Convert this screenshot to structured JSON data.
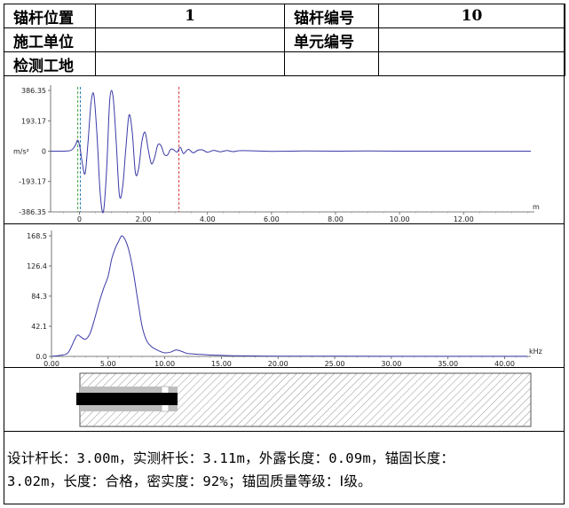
{
  "info_table": {
    "anchor_position_label": "锚杆位置",
    "anchor_position_value": "1",
    "anchor_number_label": "锚杆编号",
    "anchor_number_value": "10",
    "construction_unit_label": "施工单位",
    "construction_unit_value": "",
    "unit_number_label": "单元编号",
    "unit_number_value": "",
    "site_label": "检测工地",
    "site_value": ""
  },
  "chart_data": [
    {
      "type": "line",
      "xlabel": "m",
      "ylabel": "m/s²",
      "xlim": [
        -0.9,
        14.1
      ],
      "ylim": [
        -386.35,
        386.35
      ],
      "xticks": [
        "0",
        "2.00",
        "4.00",
        "6.00",
        "8.00",
        "10.00",
        "12.00"
      ],
      "xtick_values": [
        0,
        2,
        4,
        6,
        8,
        10,
        12
      ],
      "yticks": [
        "386.35",
        "193.17",
        "0",
        "-193.17",
        "-386.35"
      ],
      "ytick_values": [
        386.35,
        193.17,
        0,
        -193.17,
        -386.35
      ],
      "markers": [
        {
          "x": -0.05,
          "color": "#2a9d2a"
        },
        {
          "x": 0.03,
          "color": "#1f77b4"
        },
        {
          "x": 3.11,
          "color": "#d62728"
        }
      ],
      "series_color": "#3a3aa8",
      "series": [
        {
          "x": [
            -0.9,
            -0.5,
            -0.3,
            -0.2,
            -0.12,
            -0.05,
            0.02,
            0.1,
            0.18,
            0.27,
            0.36,
            0.45,
            0.55,
            0.65,
            0.75,
            0.85,
            0.95,
            1.05,
            1.15,
            1.25,
            1.35,
            1.45,
            1.55,
            1.65,
            1.75,
            1.85,
            1.95,
            2.05,
            2.15,
            2.25,
            2.35,
            2.45,
            2.55,
            2.65,
            2.75,
            2.85,
            2.95,
            3.05,
            3.15,
            3.25,
            3.4,
            3.55,
            3.7,
            3.85,
            4.0,
            4.2,
            4.4,
            4.6,
            4.8,
            5.0,
            5.4,
            6.0,
            7.0,
            8.0,
            9.0,
            10.0,
            11.0,
            12.0,
            13.0,
            14.1
          ],
          "y": [
            0,
            0,
            3,
            15,
            40,
            70,
            20,
            -90,
            -140,
            60,
            300,
            360,
            100,
            -270,
            -386,
            -120,
            330,
            350,
            60,
            -280,
            -230,
            20,
            230,
            120,
            -140,
            -110,
            60,
            120,
            10,
            -80,
            -40,
            40,
            35,
            -20,
            -25,
            12,
            8,
            -6,
            25,
            -15,
            12,
            -10,
            6,
            8,
            -7,
            5,
            -4,
            4,
            -3,
            3,
            2,
            -1,
            1,
            0,
            1,
            0,
            0,
            0,
            0,
            0
          ]
        }
      ]
    },
    {
      "type": "line",
      "xlabel": "kHz",
      "ylabel": "",
      "xlim": [
        0,
        42
      ],
      "ylim": [
        0,
        168.5
      ],
      "xticks": [
        "0.00",
        "5.00",
        "10.00",
        "15.00",
        "20.00",
        "25.00",
        "30.00",
        "35.00",
        "40.00"
      ],
      "xtick_values": [
        0,
        5,
        10,
        15,
        20,
        25,
        30,
        35,
        40
      ],
      "yticks": [
        "168.5",
        "126.4",
        "84.3",
        "42.1",
        "0.0"
      ],
      "ytick_values": [
        168.5,
        126.4,
        84.3,
        42.1,
        0
      ],
      "series_color": "#3a3aa8",
      "series": [
        {
          "x": [
            0,
            1,
            1.5,
            2,
            2.3,
            2.6,
            3,
            3.4,
            3.8,
            4.2,
            4.6,
            5,
            5.3,
            5.6,
            5.9,
            6.2,
            6.5,
            6.8,
            7.2,
            7.6,
            8,
            8.4,
            8.8,
            9.2,
            9.6,
            10,
            10.5,
            11,
            11.5,
            12,
            13,
            14,
            15,
            16,
            18,
            20,
            25,
            30,
            35,
            40,
            42
          ],
          "y": [
            0,
            2,
            6,
            22,
            30,
            27,
            24,
            32,
            52,
            75,
            95,
            112,
            135,
            150,
            160,
            168.5,
            163,
            150,
            120,
            80,
            42,
            22,
            14,
            10,
            7,
            5,
            6,
            9,
            7,
            4,
            3,
            2,
            1.5,
            1,
            0.6,
            0.4,
            0.2,
            0.1,
            0.1,
            0.1,
            0.1
          ]
        }
      ]
    }
  ],
  "summary_line1": "设计杆长：3.00m，实测杆长：3.11m，外露长度：0.09m，锚固长度：",
  "summary_line2": "3.02m，长度：合格，密实度：92%；锚固质量等级：Ⅰ级。"
}
